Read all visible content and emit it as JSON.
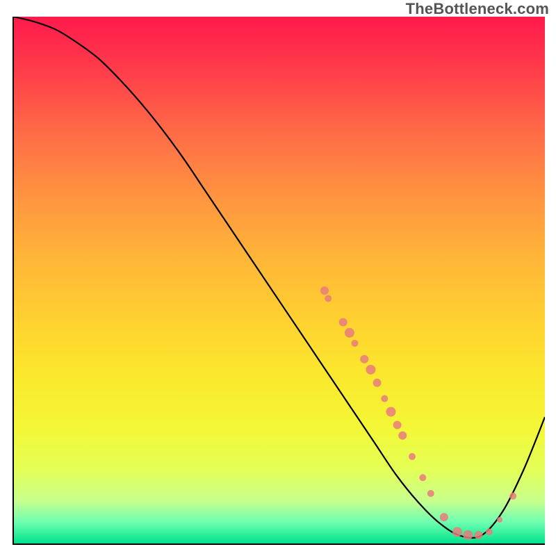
{
  "watermark": "TheBottleneck.com",
  "chart_data": {
    "type": "line",
    "title": "",
    "xlabel": "",
    "ylabel": "",
    "xlim": [
      0,
      100
    ],
    "ylim": [
      0,
      100
    ],
    "series": [
      {
        "name": "curve",
        "x": [
          0,
          4,
          8,
          12,
          16,
          20,
          24,
          28,
          32,
          36,
          40,
          44,
          48,
          52,
          56,
          60,
          64,
          68,
          72,
          76,
          80,
          84,
          88,
          92,
          96,
          100
        ],
        "y": [
          100,
          99,
          97.5,
          95,
          92,
          88,
          83.5,
          78.5,
          73,
          67,
          61,
          55,
          49,
          43,
          37,
          31,
          25,
          19,
          13,
          8,
          4,
          1.5,
          1.5,
          6,
          14,
          24
        ]
      }
    ],
    "markers": [
      {
        "x": 58.5,
        "y": 48,
        "r": 6
      },
      {
        "x": 59.2,
        "y": 46.5,
        "r": 5
      },
      {
        "x": 62,
        "y": 42,
        "r": 6
      },
      {
        "x": 63.2,
        "y": 40,
        "r": 7
      },
      {
        "x": 64.2,
        "y": 38,
        "r": 5
      },
      {
        "x": 66,
        "y": 35,
        "r": 6
      },
      {
        "x": 67.2,
        "y": 33,
        "r": 7
      },
      {
        "x": 68.4,
        "y": 30.5,
        "r": 6
      },
      {
        "x": 69.8,
        "y": 27.5,
        "r": 5
      },
      {
        "x": 71,
        "y": 25,
        "r": 7
      },
      {
        "x": 72.2,
        "y": 22.5,
        "r": 6
      },
      {
        "x": 73.2,
        "y": 20.5,
        "r": 6
      },
      {
        "x": 75,
        "y": 16.5,
        "r": 5
      },
      {
        "x": 77,
        "y": 12.5,
        "r": 5
      },
      {
        "x": 78.5,
        "y": 9.5,
        "r": 5
      },
      {
        "x": 81,
        "y": 5,
        "r": 6
      },
      {
        "x": 83.5,
        "y": 2.2,
        "r": 7
      },
      {
        "x": 85.5,
        "y": 1.6,
        "r": 7
      },
      {
        "x": 87.5,
        "y": 1.6,
        "r": 6
      },
      {
        "x": 89.5,
        "y": 2.2,
        "r": 5
      },
      {
        "x": 91.5,
        "y": 4.5,
        "r": 4
      },
      {
        "x": 94,
        "y": 9,
        "r": 5
      }
    ]
  }
}
